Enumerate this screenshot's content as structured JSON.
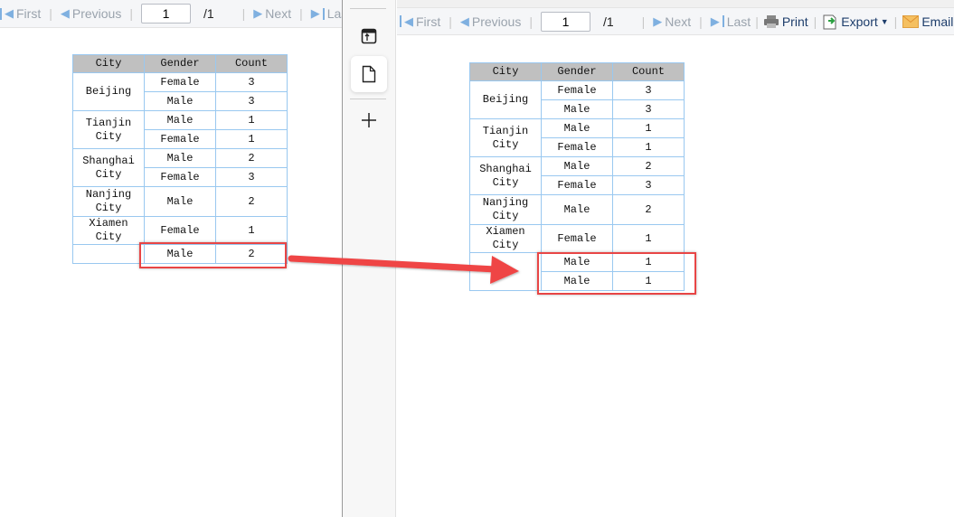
{
  "toolbar": {
    "first": "First",
    "previous": "Previous",
    "page": "1",
    "total": "/1",
    "next": "Next",
    "last": "Last",
    "print": "Print",
    "export": "Export",
    "email": "Email"
  },
  "table_headers": [
    "City",
    "Gender",
    "Count"
  ],
  "left_table": {
    "rows": [
      {
        "city": "Beijing",
        "gender": "Female",
        "count": "3"
      },
      {
        "gender": "Male",
        "count": "3"
      },
      {
        "city": "Tianjin City",
        "gender": "Male",
        "count": "1"
      },
      {
        "gender": "Female",
        "count": "1"
      },
      {
        "city": "Shanghai City",
        "gender": "Male",
        "count": "2"
      },
      {
        "gender": "Female",
        "count": "3"
      },
      {
        "city": "Nanjing City",
        "gender": "Male",
        "count": "2"
      },
      {
        "city": "Xiamen City",
        "gender": "Female",
        "count": "1"
      },
      {
        "city": "",
        "gender": "Male",
        "count": "2"
      }
    ]
  },
  "right_table": {
    "rows": [
      {
        "city": "Beijing",
        "gender": "Female",
        "count": "3"
      },
      {
        "gender": "Male",
        "count": "3"
      },
      {
        "city": "Tianjin City",
        "gender": "Male",
        "count": "1"
      },
      {
        "gender": "Female",
        "count": "1"
      },
      {
        "city": "Shanghai City",
        "gender": "Male",
        "count": "2"
      },
      {
        "gender": "Female",
        "count": "3"
      },
      {
        "city": "Nanjing City",
        "gender": "Male",
        "count": "2"
      },
      {
        "city": "Xiamen City",
        "gender": "Female",
        "count": "1"
      },
      {
        "city": "",
        "gender": "Male",
        "count": "1"
      },
      {
        "gender": "Male",
        "count": "1"
      }
    ]
  },
  "colors": {
    "highlight": "#e84545",
    "header_bg": "#c0c0c0",
    "border": "#99c8f0"
  }
}
